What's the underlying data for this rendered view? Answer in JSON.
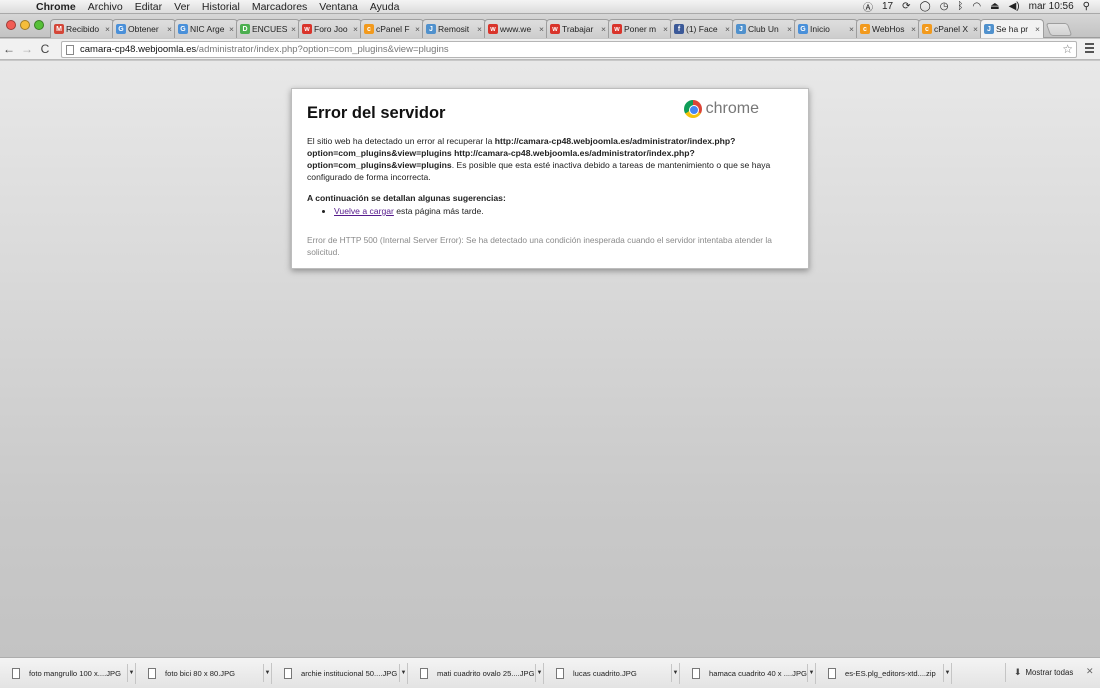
{
  "menubar": {
    "app": "Chrome",
    "items": [
      "Archivo",
      "Editar",
      "Ver",
      "Historial",
      "Marcadores",
      "Ventana",
      "Ayuda"
    ],
    "status_count": "17",
    "clock": "mar 10:56"
  },
  "tabs": [
    {
      "title": "Recibido",
      "icon": "gmail-icon",
      "color": "#d44638",
      "glyph": "M"
    },
    {
      "title": "Obtener",
      "icon": "globe-icon",
      "color": "#4a90d9",
      "glyph": "G"
    },
    {
      "title": "NIC Arge",
      "icon": "globe-icon",
      "color": "#4a90d9",
      "glyph": "G"
    },
    {
      "title": "ENCUES",
      "icon": "drive-icon",
      "color": "#4caf50",
      "glyph": "D"
    },
    {
      "title": "Foro Joo",
      "icon": "webhost-icon",
      "color": "#d9342b",
      "glyph": "w"
    },
    {
      "title": "cPanel F",
      "icon": "cpanel-icon",
      "color": "#f29a1d",
      "glyph": "c"
    },
    {
      "title": "Remosit",
      "icon": "joomla-icon",
      "color": "#5091cd",
      "glyph": "J"
    },
    {
      "title": "www.we",
      "icon": "webhost-icon",
      "color": "#d9342b",
      "glyph": "w"
    },
    {
      "title": "Trabajar",
      "icon": "webhost-icon",
      "color": "#d9342b",
      "glyph": "w"
    },
    {
      "title": "Poner m",
      "icon": "webhost-icon",
      "color": "#d9342b",
      "glyph": "w"
    },
    {
      "title": "(1) Face",
      "icon": "facebook-icon",
      "color": "#3b5998",
      "glyph": "f"
    },
    {
      "title": "Club Un",
      "icon": "joomla-icon",
      "color": "#5091cd",
      "glyph": "J"
    },
    {
      "title": "Inicio",
      "icon": "gear-globe-icon",
      "color": "#4a90d9",
      "glyph": "G"
    },
    {
      "title": "WebHos",
      "icon": "cpanel-icon",
      "color": "#f29a1d",
      "glyph": "c"
    },
    {
      "title": "cPanel X",
      "icon": "cpanel-icon",
      "color": "#f29a1d",
      "glyph": "c"
    },
    {
      "title": "Se ha pr",
      "icon": "joomla-icon",
      "color": "#5091cd",
      "glyph": "J",
      "active": true
    }
  ],
  "toolbar": {
    "url_host": "camara-cp48.webjoomla.es",
    "url_path": "/administrator/index.php?option=com_plugins&view=plugins"
  },
  "error": {
    "title": "Error del servidor",
    "brand": "chrome",
    "intro_before": "El sitio web ha detectado un error al recuperar la ",
    "url_bold": "http://camara-cp48.webjoomla.es/administrator/index.php?option=com_plugins&view=plugins http://camara-cp48.webjoomla.es/administrator/index.php?option=com_plugins&view=plugins",
    "intro_after": ". Es posible que esta esté inactiva debido a tareas de mantenimiento o que se haya configurado de forma incorrecta.",
    "suggestions_heading": "A continuación se detallan algunas sugerencias:",
    "suggestion_link": "Vuelve a cargar",
    "suggestion_rest": " esta página más tarde.",
    "detail": "Error de HTTP 500 (Internal Server Error): Se ha detectado una condición inesperada cuando el servidor intentaba atender la solicitud."
  },
  "downloads": {
    "items": [
      "foto mangrullo 100  x....JPG",
      "foto bici 80  x 80.JPG",
      "archie institucional 50....JPG",
      "mati cuadrito ovalo 25....JPG",
      "lucas cuadrito.JPG",
      "hamaca cuadrito 40 x ....JPG",
      "es-ES.plg_editors-xtd....zip"
    ],
    "show_all": "Mostrar todas"
  }
}
